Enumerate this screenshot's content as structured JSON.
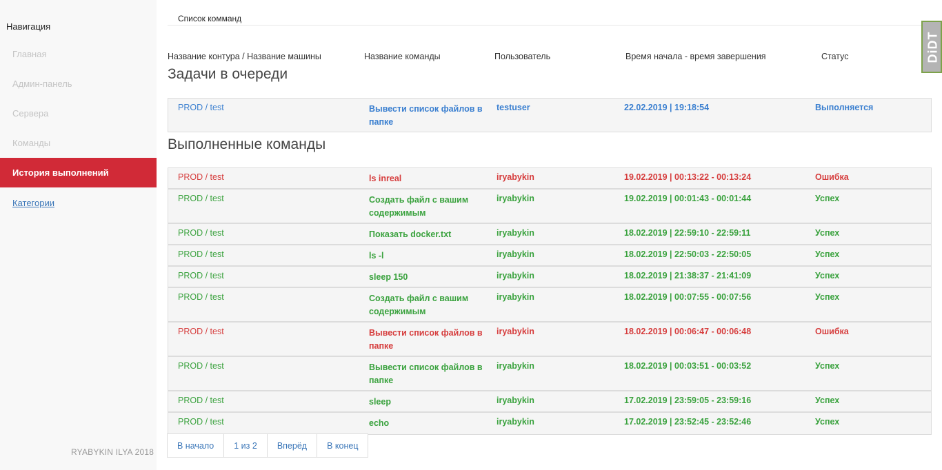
{
  "sidebar": {
    "heading": "Навигация",
    "items": [
      {
        "label": "Главная"
      },
      {
        "label": "Админ-панель"
      },
      {
        "label": "Сервера"
      },
      {
        "label": "Команды"
      },
      {
        "label": "История выполнений"
      },
      {
        "label": "Категории"
      }
    ],
    "footer": "RYABYKIN ILYA 2018"
  },
  "breadcrumb": "Список комманд",
  "columns": [
    "Название контура / Название машины",
    "Название команды",
    "Пользователь",
    "Время начала - время завершения",
    "Статус"
  ],
  "queue": {
    "title": "Задачи в очереди",
    "rows": [
      {
        "machine": "PROD / test",
        "command": "Вывести список файлов в папке",
        "user": "testuser",
        "time": "22.02.2019 | 19:18:54",
        "status": "Выполняется"
      }
    ]
  },
  "done": {
    "title": "Выполненные команды",
    "rows": [
      {
        "machine": "PROD / test",
        "command": "ls inreal",
        "user": "iryabykin",
        "time": "19.02.2019 | 00:13:22 - 00:13:24",
        "status": "Ошибка"
      },
      {
        "machine": "PROD / test",
        "command": "Создать файл с вашим содержимым",
        "user": "iryabykin",
        "time": "19.02.2019 | 00:01:43 - 00:01:44",
        "status": "Успех"
      },
      {
        "machine": "PROD / test",
        "command": "Показать docker.txt",
        "user": "iryabykin",
        "time": "18.02.2019 | 22:59:10 - 22:59:11",
        "status": "Успех"
      },
      {
        "machine": "PROD / test",
        "command": "ls -l",
        "user": "iryabykin",
        "time": "18.02.2019 | 22:50:03 - 22:50:05",
        "status": "Успех"
      },
      {
        "machine": "PROD / test",
        "command": "sleep 150",
        "user": "iryabykin",
        "time": "18.02.2019 | 21:38:37 - 21:41:09",
        "status": "Успех"
      },
      {
        "machine": "PROD / test",
        "command": "Создать файл с вашим содержимым",
        "user": "iryabykin",
        "time": "18.02.2019 | 00:07:55 - 00:07:56",
        "status": "Успех"
      },
      {
        "machine": "PROD / test",
        "command": "Вывести список файлов в папке",
        "user": "iryabykin",
        "time": "18.02.2019 | 00:06:47 - 00:06:48",
        "status": "Ошибка"
      },
      {
        "machine": "PROD / test",
        "command": "Вывести список файлов в папке",
        "user": "iryabykin",
        "time": "18.02.2019 | 00:03:51 - 00:03:52",
        "status": "Успех"
      },
      {
        "machine": "PROD / test",
        "command": "sleep",
        "user": "iryabykin",
        "time": "17.02.2019 | 23:59:05 - 23:59:16",
        "status": "Успех"
      },
      {
        "machine": "PROD / test",
        "command": "echo",
        "user": "iryabykin",
        "time": "17.02.2019 | 23:52:45 - 23:52:46",
        "status": "Успех"
      }
    ]
  },
  "pagination": {
    "first": "В начало",
    "current": "1 из 2",
    "next": "Вперёд",
    "last": "В конец"
  },
  "badge": "DiDT",
  "colors": {
    "queued": "#3a7fd0",
    "error": "#d63d3d",
    "success": "#3aa23e",
    "active_nav": "#d12a37"
  }
}
